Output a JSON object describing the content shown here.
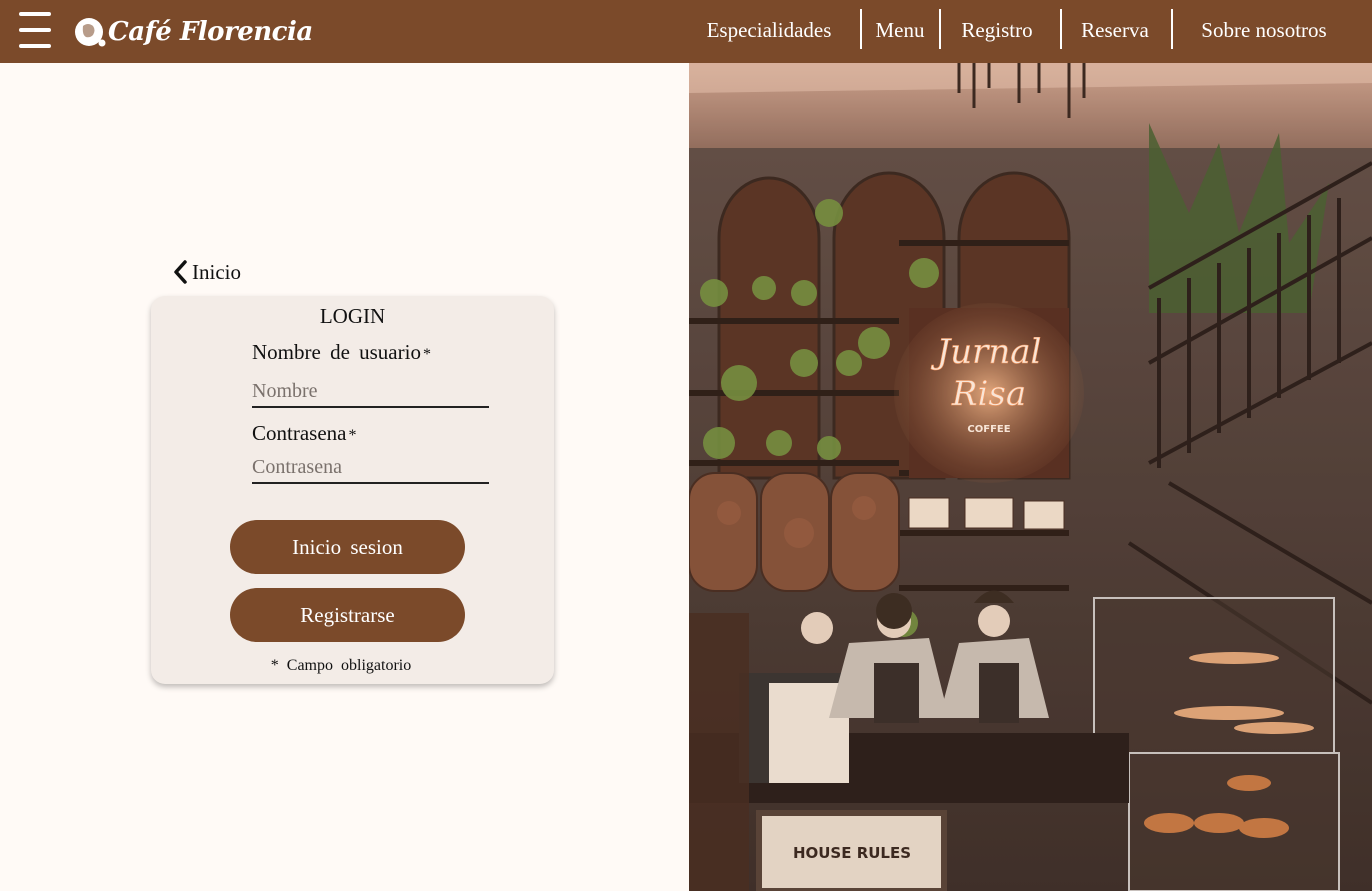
{
  "header": {
    "brand_name": "Café Florencia",
    "nav": [
      "Especialidades",
      "Menu",
      "Registro",
      "Reserva",
      "Sobre nosotros"
    ]
  },
  "back_link": {
    "label": "Inicio"
  },
  "login": {
    "title": "LOGIN",
    "username_label": "Nombre de usuario",
    "username_placeholder": "Nombre",
    "password_label": "Contrasena",
    "password_placeholder": "Contrasena",
    "required_mark": "*",
    "login_button": "Inicio sesion",
    "register_button": "Registrarse",
    "required_note": "* Campo obligatorio"
  },
  "hero_image": {
    "neon_line1": "Jurnal",
    "neon_line2": "Risa",
    "neon_line3": "COFFEE",
    "sign": "HOUSE RULES"
  },
  "colors": {
    "brand": "#7b4a2a",
    "background": "#fffaf6",
    "card": "#f3ece7"
  }
}
